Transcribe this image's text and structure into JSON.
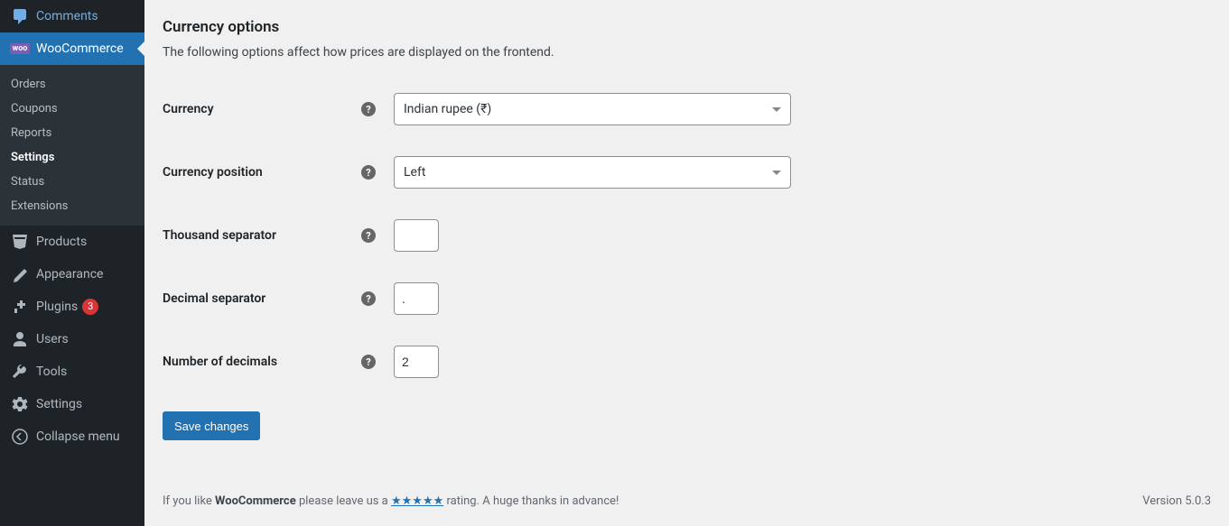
{
  "sidebar": {
    "comments": "Comments",
    "woocommerce": "WooCommerce",
    "wc_badge": "woo",
    "submenu": {
      "orders": "Orders",
      "coupons": "Coupons",
      "reports": "Reports",
      "settings": "Settings",
      "status": "Status",
      "extensions": "Extensions"
    },
    "products": "Products",
    "appearance": "Appearance",
    "plugins": "Plugins",
    "plugins_count": "3",
    "users": "Users",
    "tools": "Tools",
    "settings_main": "Settings",
    "collapse": "Collapse menu"
  },
  "main": {
    "heading": "Currency options",
    "description": "The following options affect how prices are displayed on the frontend.",
    "labels": {
      "currency": "Currency",
      "currency_position": "Currency position",
      "thousand_separator": "Thousand separator",
      "decimal_separator": "Decimal separator",
      "number_of_decimals": "Number of decimals"
    },
    "values": {
      "currency": "Indian rupee (₹)",
      "currency_position": "Left",
      "thousand_separator": "",
      "decimal_separator": ".",
      "number_of_decimals": "2"
    },
    "save_button": "Save changes"
  },
  "footer": {
    "prefix": "If you like ",
    "brand": "WooCommerce",
    "mid": " please leave us a ",
    "stars": "★★★★★",
    "suffix": " rating. A huge thanks in advance!",
    "version": "Version 5.0.3"
  }
}
